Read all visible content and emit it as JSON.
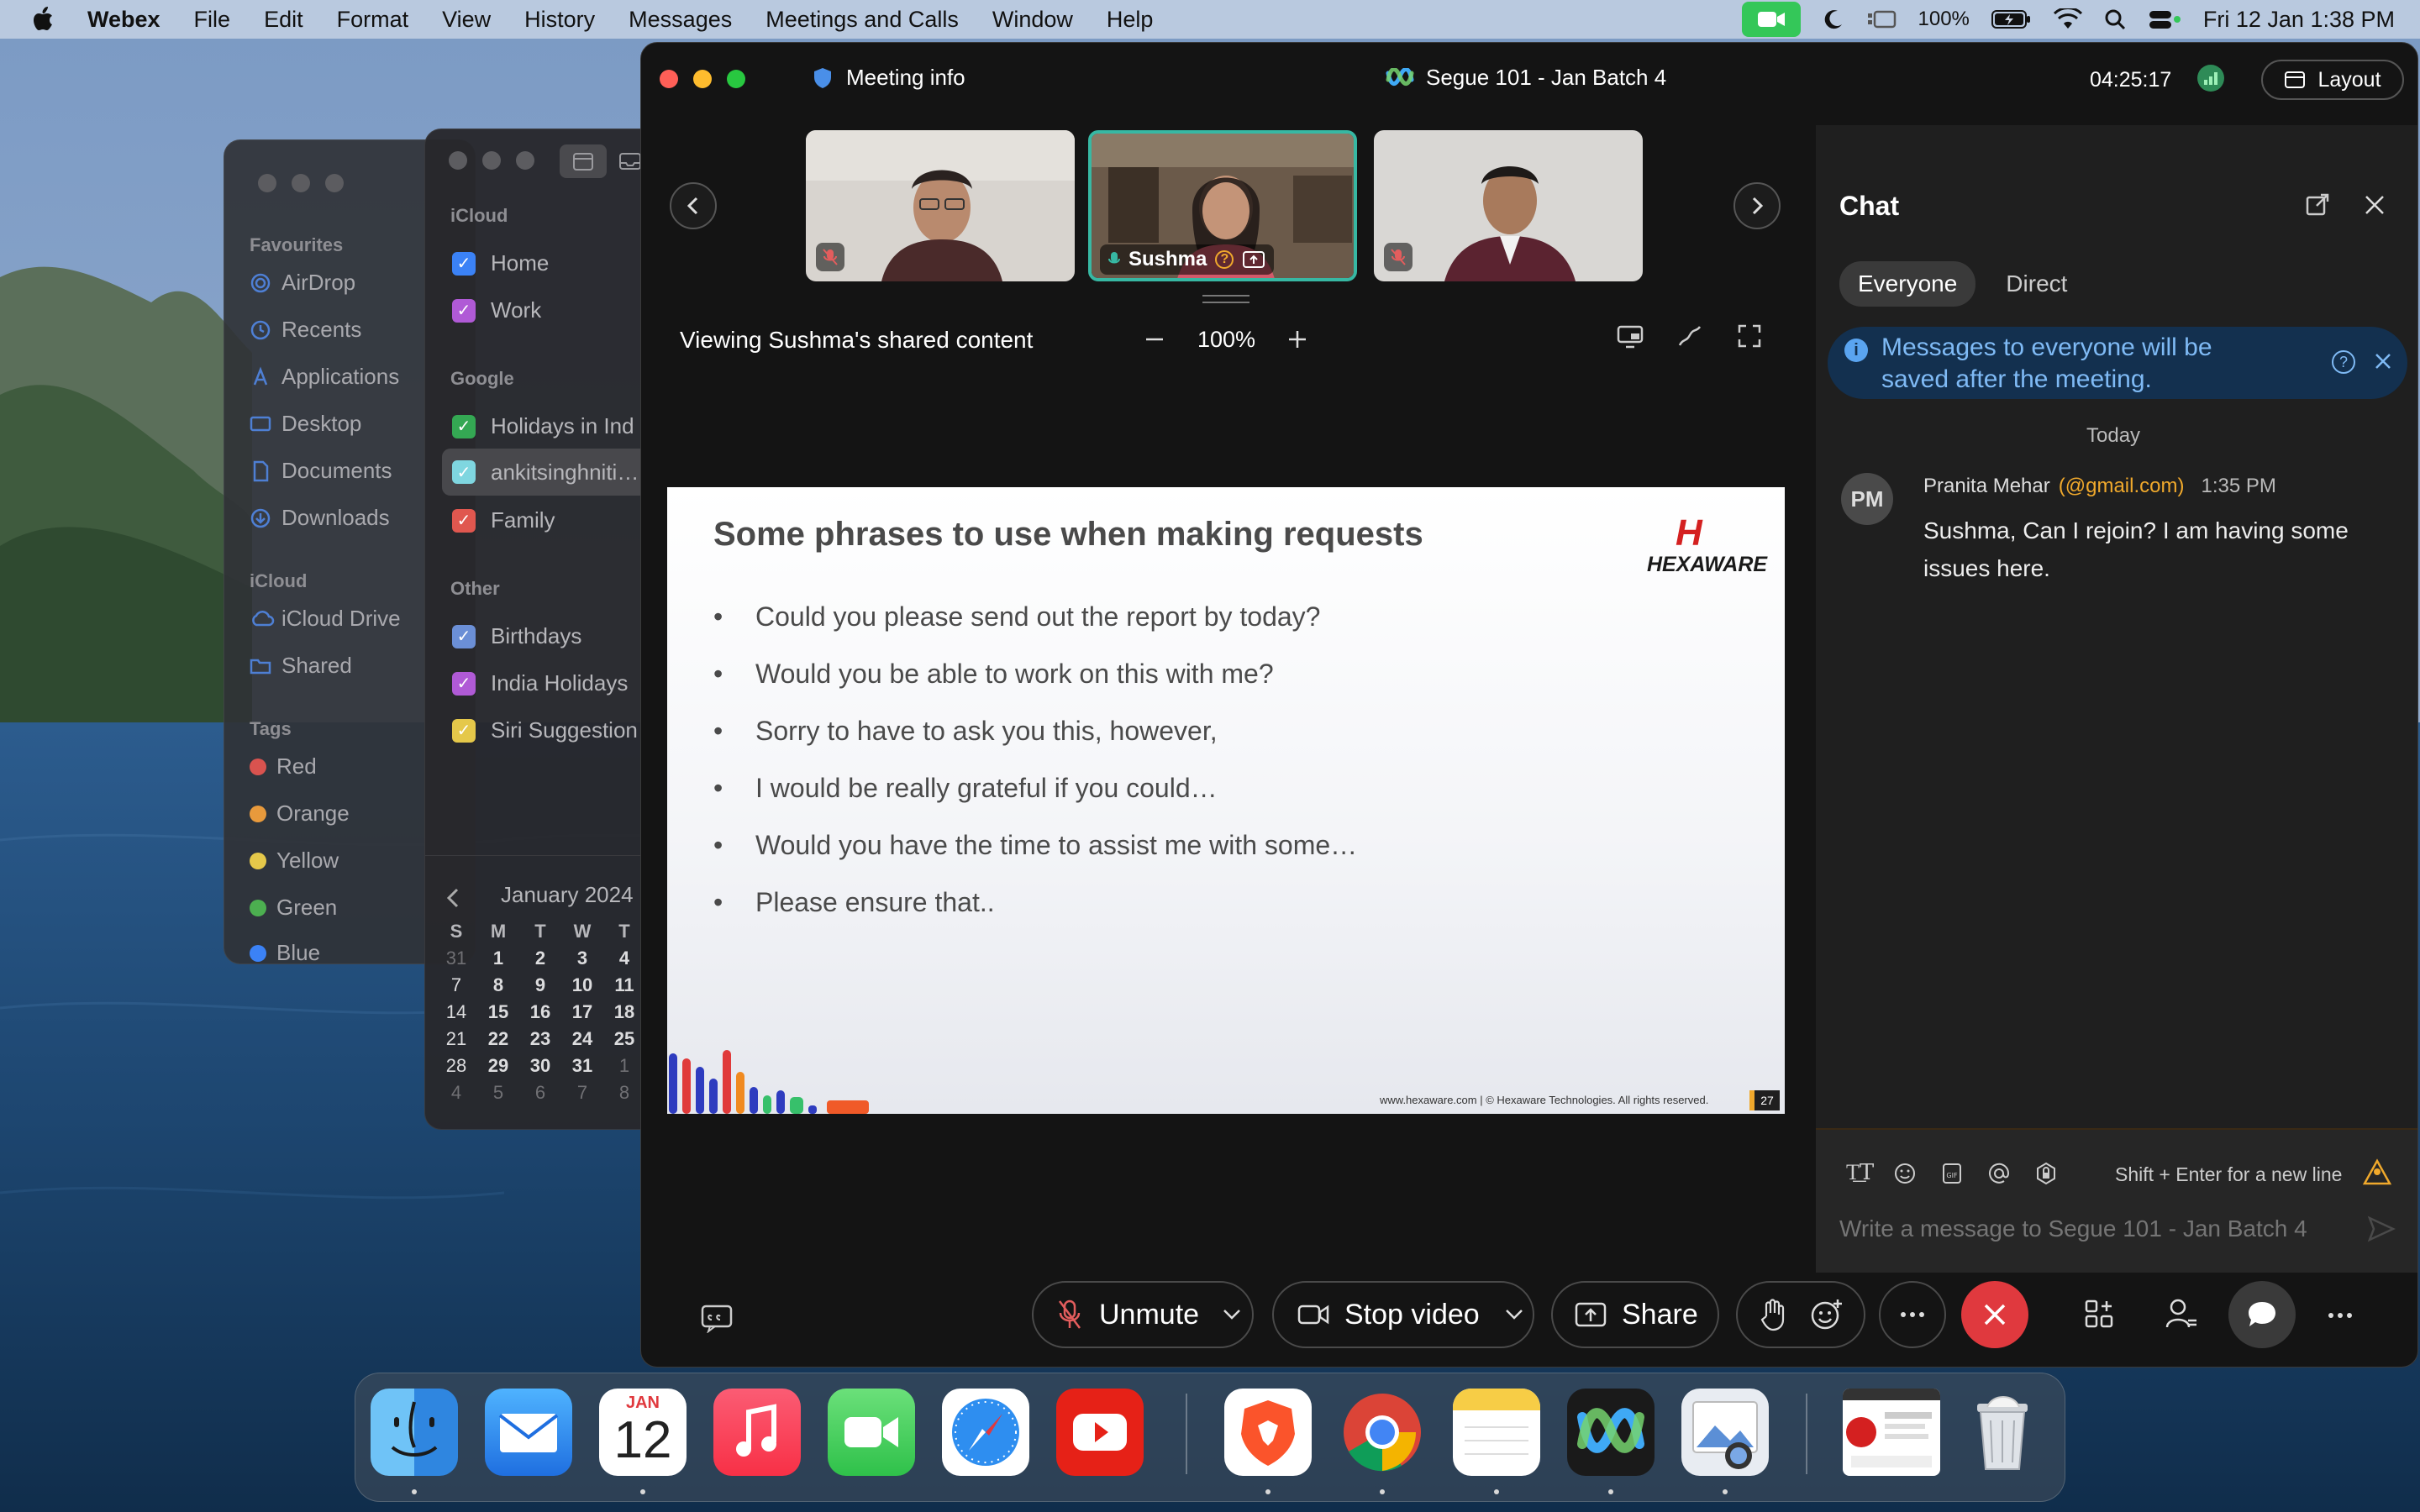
{
  "menubar": {
    "app_name": "Webex",
    "menus": [
      "File",
      "Edit",
      "Format",
      "View",
      "History",
      "Messages",
      "Meetings and Calls",
      "Window",
      "Help"
    ],
    "battery": "100%",
    "datetime": "Fri 12 Jan  1:38 PM"
  },
  "finder": {
    "favourites_title": "Favourites",
    "favourites": [
      "AirDrop",
      "Recents",
      "Applications",
      "Desktop",
      "Documents",
      "Downloads"
    ],
    "icloud_title": "iCloud",
    "icloud": [
      "iCloud Drive",
      "Shared"
    ],
    "tags_title": "Tags",
    "tags": [
      {
        "label": "Red",
        "color": "#d9534f"
      },
      {
        "label": "Orange",
        "color": "#e89a3c"
      },
      {
        "label": "Yellow",
        "color": "#e5c84a"
      },
      {
        "label": "Green",
        "color": "#4caf50"
      },
      {
        "label": "Blue",
        "color": "#3b82f6"
      }
    ]
  },
  "calendar": {
    "groups": [
      {
        "title": "iCloud",
        "items": [
          {
            "label": "Home",
            "color": "#3b82f6"
          },
          {
            "label": "Work",
            "color": "#b05ad6"
          }
        ]
      },
      {
        "title": "Google",
        "items": [
          {
            "label": "Holidays in Ind",
            "color": "#34a853"
          },
          {
            "label": "ankitsinghniti…",
            "color": "#7fd6e0"
          },
          {
            "label": "Family",
            "color": "#e0574f"
          }
        ]
      },
      {
        "title": "Other",
        "items": [
          {
            "label": "Birthdays",
            "color": "#6b8fd6"
          },
          {
            "label": "India Holidays",
            "color": "#b05ad6"
          },
          {
            "label": "Siri Suggestion",
            "color": "#e5c84a"
          }
        ]
      }
    ],
    "month_label": "January 2024",
    "weekdays": [
      "S",
      "M",
      "T",
      "W",
      "T"
    ],
    "weeks": [
      [
        "31",
        "1",
        "2",
        "3",
        "4"
      ],
      [
        "7",
        "8",
        "9",
        "10",
        "11"
      ],
      [
        "14",
        "15",
        "16",
        "17",
        "18"
      ],
      [
        "21",
        "22",
        "23",
        "24",
        "25"
      ],
      [
        "28",
        "29",
        "30",
        "31",
        "1"
      ],
      [
        "4",
        "5",
        "6",
        "7",
        "8"
      ]
    ]
  },
  "webex": {
    "meeting_info": "Meeting info",
    "meeting_title": "Segue 101 - Jan Batch 4",
    "timer": "04:25:17",
    "layout_label": "Layout",
    "active_speaker": "Sushma",
    "viewing_label": "Viewing Sushma's shared content",
    "zoom": "100%",
    "slide": {
      "title": "Some phrases to use when making requests",
      "logo_text": "HEXAWARE",
      "bullets": [
        "Could you please send out the report by today?",
        "Would you be able to work on this with me?",
        "Sorry to have to ask you this, however,",
        "I would be really grateful if you could…",
        "Would you have the time to assist me with some…",
        "Please ensure that.."
      ],
      "footer": "www.hexaware.com  | © Hexaware Technologies. All rights reserved.",
      "page": "27"
    },
    "controls": {
      "unmute": "Unmute",
      "stop_video": "Stop video",
      "share": "Share"
    }
  },
  "chat": {
    "title": "Chat",
    "tabs": [
      "Everyone",
      "Direct"
    ],
    "notice": "Messages to everyone will be saved after the meeting.",
    "day_label": "Today",
    "messages": [
      {
        "initials": "PM",
        "sender": "Pranita Mehar",
        "email": "(@gmail.com)",
        "time": "1:35 PM",
        "text": "Sushma, Can I rejoin? I am having some issues here."
      }
    ],
    "shortcut_hint": "Shift + Enter for a new line",
    "input_placeholder": "Write a message to Segue 101 - Jan Batch 4"
  },
  "dock": {
    "calendar_month": "JAN",
    "calendar_day": "12"
  }
}
